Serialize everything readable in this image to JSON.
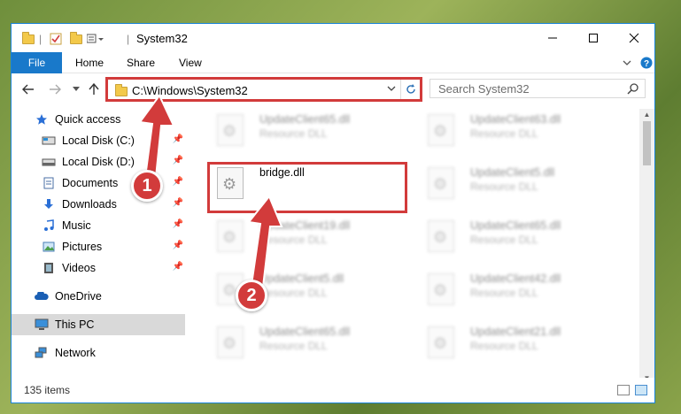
{
  "window": {
    "title": "System32"
  },
  "ribbon": {
    "file": "File",
    "home": "Home",
    "share": "Share",
    "view": "View"
  },
  "address": {
    "path": "C:\\Windows\\System32"
  },
  "search": {
    "placeholder": "Search System32"
  },
  "sidebar": {
    "items": [
      {
        "label": "Quick access"
      },
      {
        "label": "Local Disk (C:)"
      },
      {
        "label": "Local Disk (D:)"
      },
      {
        "label": "Documents"
      },
      {
        "label": "Downloads"
      },
      {
        "label": "Music"
      },
      {
        "label": "Pictures"
      },
      {
        "label": "Videos"
      },
      {
        "label": "OneDrive"
      },
      {
        "label": "This PC"
      },
      {
        "label": "Network"
      }
    ]
  },
  "files": {
    "left": [
      {
        "name": "UpdateClient65.dll",
        "type": "Resource DLL"
      },
      {
        "name": "bridge.dll",
        "type": ""
      },
      {
        "name": "UpdateClient19.dll",
        "type": "Resource DLL"
      },
      {
        "name": "UpdateClient5.dll",
        "type": "Resource DLL"
      },
      {
        "name": "UpdateClient65.dll",
        "type": "Resource DLL"
      }
    ],
    "right": [
      {
        "name": "UpdateClient63.dll",
        "type": "Resource DLL"
      },
      {
        "name": "UpdateClient5.dll",
        "type": "Resource DLL"
      },
      {
        "name": "UpdateClient65.dll",
        "type": "Resource DLL"
      },
      {
        "name": "UpdateClient42.dll",
        "type": "Resource DLL"
      },
      {
        "name": "UpdateClient21.dll",
        "type": "Resource DLL"
      }
    ]
  },
  "status": {
    "count": "135 items"
  },
  "annotations": {
    "step1": "1",
    "step2": "2"
  },
  "colors": {
    "accent": "#1979ca",
    "highlight": "#d23b3b"
  }
}
